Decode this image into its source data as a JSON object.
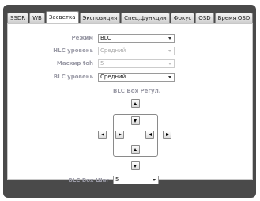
{
  "tabs": [
    {
      "label": "SSDR",
      "active": false
    },
    {
      "label": "WB",
      "active": false
    },
    {
      "label": "Засветка",
      "active": true
    },
    {
      "label": "Экспозиция",
      "active": false
    },
    {
      "label": "Спец.функции",
      "active": false
    },
    {
      "label": "Фокус",
      "active": false
    },
    {
      "label": "OSD",
      "active": false
    },
    {
      "label": "Время OSD",
      "active": false
    }
  ],
  "settings": {
    "mode": {
      "label": "Режим",
      "value": "BLC",
      "enabled": true
    },
    "hlc_level": {
      "label": "HLC уровень",
      "value": "Средний",
      "enabled": false
    },
    "mask_tone": {
      "label": "Маскир tоh",
      "value": "5",
      "enabled": false
    },
    "blc_level": {
      "label": "BLC уровень",
      "value": "Средний",
      "enabled": true
    }
  },
  "blc_box": {
    "heading": "BLC Box Регул.",
    "step_label": "BLC Box Шаг",
    "step_value": "5"
  }
}
